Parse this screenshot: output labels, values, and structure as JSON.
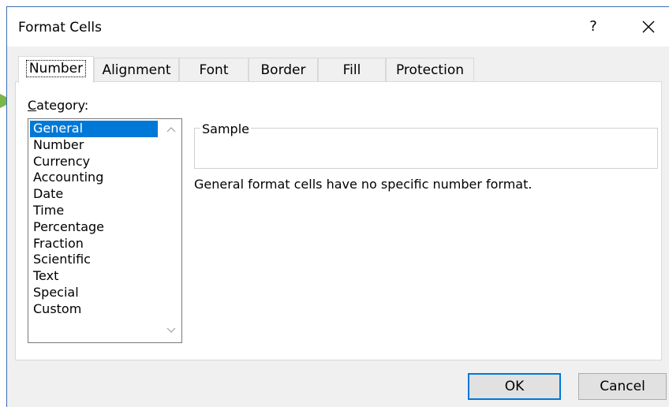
{
  "dialog": {
    "title": "Format Cells",
    "help_label": "?",
    "close_label": "✕"
  },
  "tabs": [
    {
      "label": "Number"
    },
    {
      "label": "Alignment"
    },
    {
      "label": "Font"
    },
    {
      "label": "Border"
    },
    {
      "label": "Fill"
    },
    {
      "label": "Protection"
    }
  ],
  "category": {
    "label_first": "C",
    "label_rest": "ategory:",
    "items": [
      "General",
      "Number",
      "Currency",
      "Accounting",
      "Date",
      "Time",
      "Percentage",
      "Fraction",
      "Scientific",
      "Text",
      "Special",
      "Custom"
    ],
    "selected": "General"
  },
  "sample": {
    "legend": "Sample",
    "value": ""
  },
  "description": "General format cells have no specific number format.",
  "buttons": {
    "ok": "OK",
    "cancel": "Cancel"
  },
  "colors": {
    "accent": "#0078d7",
    "pointer_arrow": "#7ab648"
  }
}
